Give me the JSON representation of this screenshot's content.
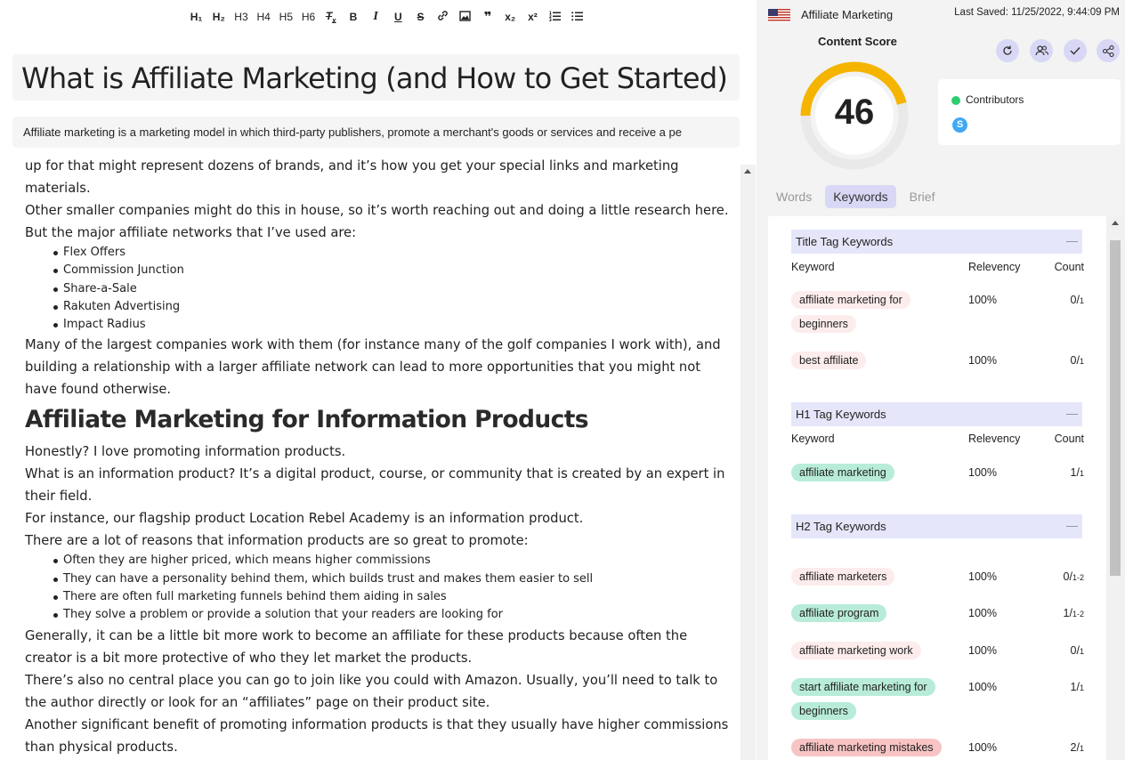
{
  "toolbar": {
    "buttons": [
      "H₁",
      "H₂",
      "H3",
      "H4",
      "H5",
      "H6",
      "Tx",
      "B",
      "I",
      "U",
      "S",
      "link",
      "image",
      "quote",
      "x₂",
      "x²",
      "ol",
      "ul"
    ]
  },
  "editor": {
    "title": "What is Affiliate Marketing (and How to Get Started)",
    "meta_description": "Affiliate marketing is a marketing model in which third-party publishers, promote a merchant's goods or services and receive a pe",
    "paragraphs": {
      "p0": "up for that might represent dozens of brands, and it’s how you get your special links and marketing materials.",
      "p1": "Other smaller companies might do this in house, so it’s worth reaching out and doing a little research here.",
      "p2": "But the major affiliate networks that I’ve used are:",
      "p3": "Many of the largest companies work with them (for instance many of the golf companies I work with), and building a relationship with a larger affiliate network can lead to more opportunities that you might not have found otherwise.",
      "h2": "Affiliate Marketing for Information Products",
      "p4": "Honestly? I love promoting information products.",
      "p5": "What is an information product? It’s a digital product, course, or community that is created by an expert in their field.",
      "p6": "For instance, our flagship product Location Rebel Academy is an information product.",
      "p7": "There are a lot of reasons that information products are so great to promote:",
      "p8": "Generally, it can be a little bit more work to become an affiliate for these products because often the creator is a bit more protective of who they let market the products.",
      "p9": "There’s also no central place you can go to join like you could with Amazon. Usually, you’ll need to talk to the author directly or look for an “affiliates” page on their product site.",
      "p10": "Another significant benefit of promoting information products is that they usually have higher commissions than physical products."
    },
    "networks": [
      "Flex Offers",
      "Commission Junction",
      "Share-a-Sale",
      "Rakuten Advertising",
      "Impact Radius"
    ],
    "reasons": [
      "Often they are higher priced, which means higher commissions",
      "They can have a personality behind them, which builds trust and makes them easier to sell",
      "There are often full marketing funnels behind them aiding in sales",
      "They solve a problem or provide a solution that your readers are looking for"
    ]
  },
  "sidebar": {
    "doc_title": "Affiliate Marketing",
    "last_saved": "Last Saved: 11/25/2022, 9:44:09 PM",
    "content_score_label": "Content Score",
    "content_score": "46",
    "score_value": 46,
    "contributors_label": "Contributors",
    "contributor_initial": "S",
    "tabs": [
      "Words",
      "Keywords",
      "Brief"
    ],
    "col_keyword": "Keyword",
    "col_relevancy": "Relevency",
    "col_count": "Count",
    "sections": {
      "title": "Title Tag Keywords",
      "h1": "H1 Tag Keywords",
      "h2": "H2 Tag Keywords"
    },
    "title_kws": [
      {
        "kw": "affiliate marketing for beginners",
        "rel": "100%",
        "cnt": "0/",
        "max": "1"
      },
      {
        "kw": "best affiliate",
        "rel": "100%",
        "cnt": "0/",
        "max": "1"
      }
    ],
    "h1_kws": [
      {
        "kw": "affiliate marketing",
        "rel": "100%",
        "cnt": "1/",
        "max": "1"
      }
    ],
    "h2_kws": [
      {
        "kw": "affiliate marketers",
        "rel": "100%",
        "cnt": "0/",
        "max": "1-2"
      },
      {
        "kw": "affiliate program",
        "rel": "100%",
        "cnt": "1/",
        "max": "1-2"
      },
      {
        "kw": "affiliate marketing work",
        "rel": "100%",
        "cnt": "0/",
        "max": "1"
      },
      {
        "kw": "start affiliate marketing for beginners",
        "rel": "100%",
        "cnt": "1/",
        "max": "1"
      },
      {
        "kw": "affiliate marketing mistakes",
        "rel": "100%",
        "cnt": "2/",
        "max": "1"
      }
    ]
  },
  "colors": {
    "gauge": "#f5b400",
    "accent": "#d8d8f6",
    "green_chip": "#b8ecd8",
    "pink_chip": "#fdecec",
    "red_chip": "#f8c4c4"
  }
}
